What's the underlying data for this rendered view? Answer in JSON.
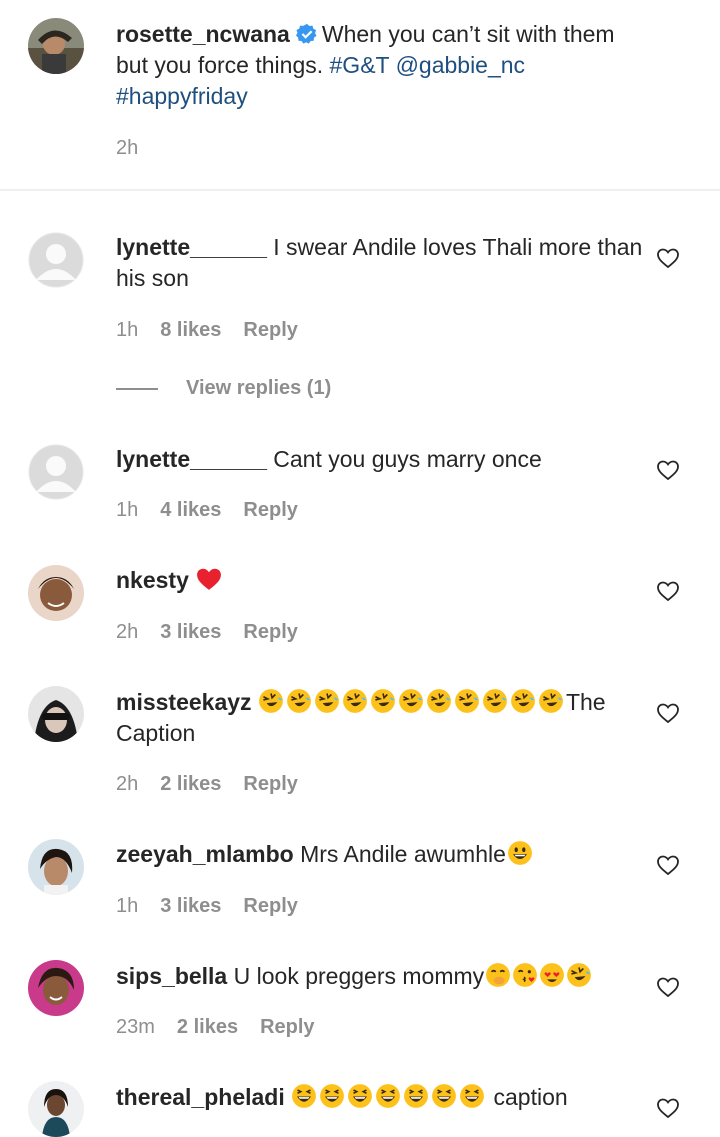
{
  "post": {
    "username": "rosette_ncwana",
    "caption_text": "When you can’t sit with them but you force things.",
    "hashtag_gt": "#G&T",
    "mention": "@gabbie_nc",
    "hashtag_friday": "#happyfriday",
    "time": "2h",
    "verified": true
  },
  "view_replies": "View replies (1)",
  "comments": [
    {
      "username": "lynette______",
      "text": "I swear Andile loves Thali more than his son",
      "time": "1h",
      "likes": "8 likes",
      "reply": "Reply"
    },
    {
      "username": "lynette______",
      "text": "Cant you guys marry once",
      "time": "1h",
      "likes": "4 likes",
      "reply": "Reply"
    },
    {
      "username": "nkesty",
      "text": "",
      "emoji": "red-heart",
      "time": "2h",
      "likes": "3 likes",
      "reply": "Reply"
    },
    {
      "username": "missteekayz",
      "text": "The Caption",
      "emoji": "rolling-on-floor-laughing",
      "emoji_count": 11,
      "time": "2h",
      "likes": "2 likes",
      "reply": "Reply"
    },
    {
      "username": "zeeyah_mlambo",
      "text": "Mrs Andile awumhle",
      "emoji": "grinning-face",
      "time": "1h",
      "likes": "3 likes",
      "reply": "Reply"
    },
    {
      "username": "sips_bella",
      "text": "U look preggers mommy",
      "emojis": [
        "face-with-hand-over-mouth",
        "face-blowing-kiss",
        "smiling-face-with-heart-eyes",
        "rolling-on-floor-laughing"
      ],
      "time": "23m",
      "likes": "2 likes",
      "reply": "Reply"
    },
    {
      "username": "thereal_pheladi",
      "text": "caption",
      "emoji": "grinning-squinting-face",
      "emoji_count": 7
    }
  ],
  "colors": {
    "text": "#262626",
    "secondary": "#8e8e8e",
    "link": "#1f4f7f",
    "verified": "#3897f0",
    "divider": "#efefef"
  }
}
